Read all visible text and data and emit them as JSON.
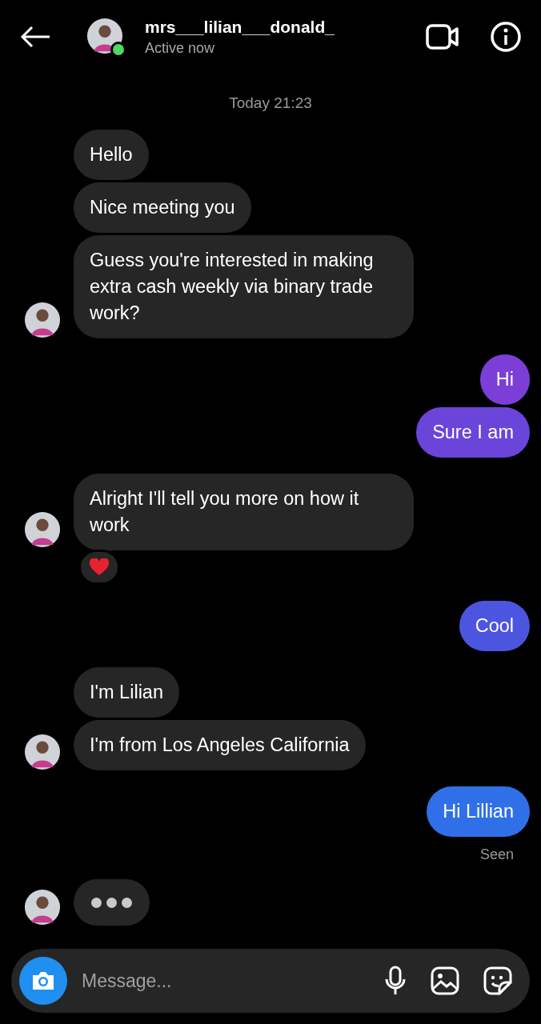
{
  "header": {
    "username": "mrs___lilian___donald_",
    "status": "Active now",
    "online": true
  },
  "timestamp": "Today 21:23",
  "groups": [
    {
      "kind": "incoming",
      "messages": [
        {
          "text": "Hello"
        },
        {
          "text": "Nice meeting you"
        },
        {
          "text": "Guess you're interested in making extra cash weekly via binary trade work?"
        }
      ]
    },
    {
      "kind": "outgoing",
      "messages": [
        {
          "text": "Hi",
          "color": "#7b3fd8"
        },
        {
          "text": "Sure I am",
          "color": "#6b45da"
        }
      ]
    },
    {
      "kind": "incoming",
      "messages": [
        {
          "text": "Alright I'll tell you more on how it work",
          "heart_reaction": true
        }
      ]
    },
    {
      "kind": "outgoing",
      "messages": [
        {
          "text": "Cool",
          "color": "#4c55e0"
        }
      ]
    },
    {
      "kind": "incoming",
      "messages": [
        {
          "text": "I'm Lilian"
        },
        {
          "text": "I'm from Los Angeles California"
        }
      ]
    },
    {
      "kind": "outgoing",
      "messages": [
        {
          "text": "Hi Lillian",
          "color": "#2f70e8"
        }
      ],
      "receipt": "Seen"
    },
    {
      "kind": "incoming",
      "typing": true
    }
  ],
  "composer": {
    "placeholder": "Message..."
  }
}
